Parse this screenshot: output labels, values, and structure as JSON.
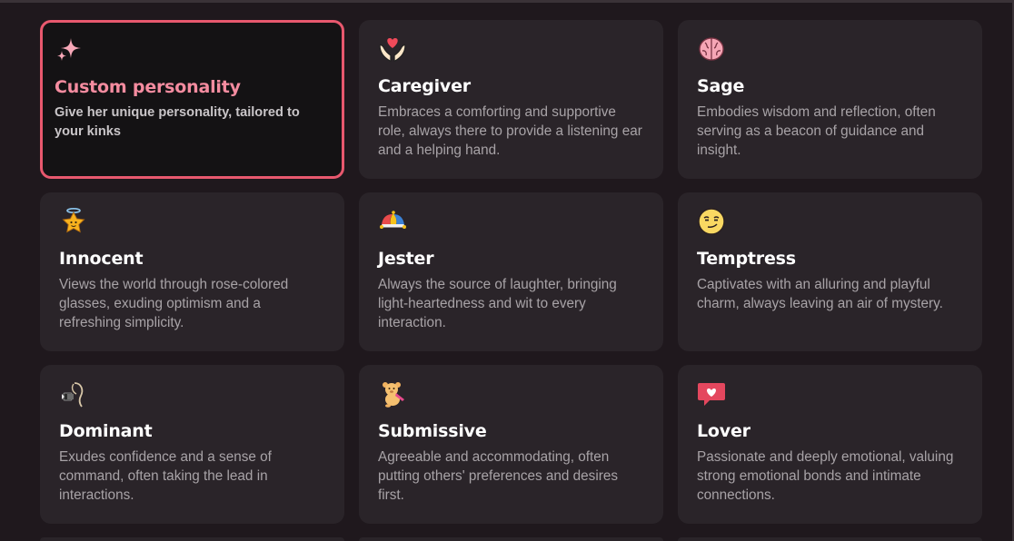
{
  "cards": [
    {
      "title": "Custom personality",
      "desc": "Give her unique personality, tailored to your kinks",
      "icon": "sparkles-icon",
      "selected": true
    },
    {
      "title": "Caregiver",
      "desc": "Embraces a comforting and supportive role, always there to provide a listening ear and a helping hand.",
      "icon": "heart-hands-icon"
    },
    {
      "title": "Sage",
      "desc": "Embodies wisdom and reflection, often serving as a beacon of guidance and insight.",
      "icon": "brain-icon"
    },
    {
      "title": "Innocent",
      "desc": "Views the world through rose-colored glasses, exuding optimism and a refreshing simplicity.",
      "icon": "halo-star-icon"
    },
    {
      "title": "Jester",
      "desc": "Always the source of laughter, bringing light-heartedness and wit to every interaction.",
      "icon": "jester-hat-icon"
    },
    {
      "title": "Temptress",
      "desc": "Captivates with an alluring and playful charm, always leaving an air of mystery.",
      "icon": "smirk-face-icon"
    },
    {
      "title": "Dominant",
      "desc": "Exudes confidence and a sense of command, often taking the lead in interactions.",
      "icon": "whip-icon"
    },
    {
      "title": "Submissive",
      "desc": "Agreeable and accommodating, often putting others' preferences and desires first.",
      "icon": "bear-icon"
    },
    {
      "title": "Lover",
      "desc": "Passionate and deeply emotional, valuing strong emotional bonds and intimate connections.",
      "icon": "heart-bubble-icon"
    }
  ]
}
